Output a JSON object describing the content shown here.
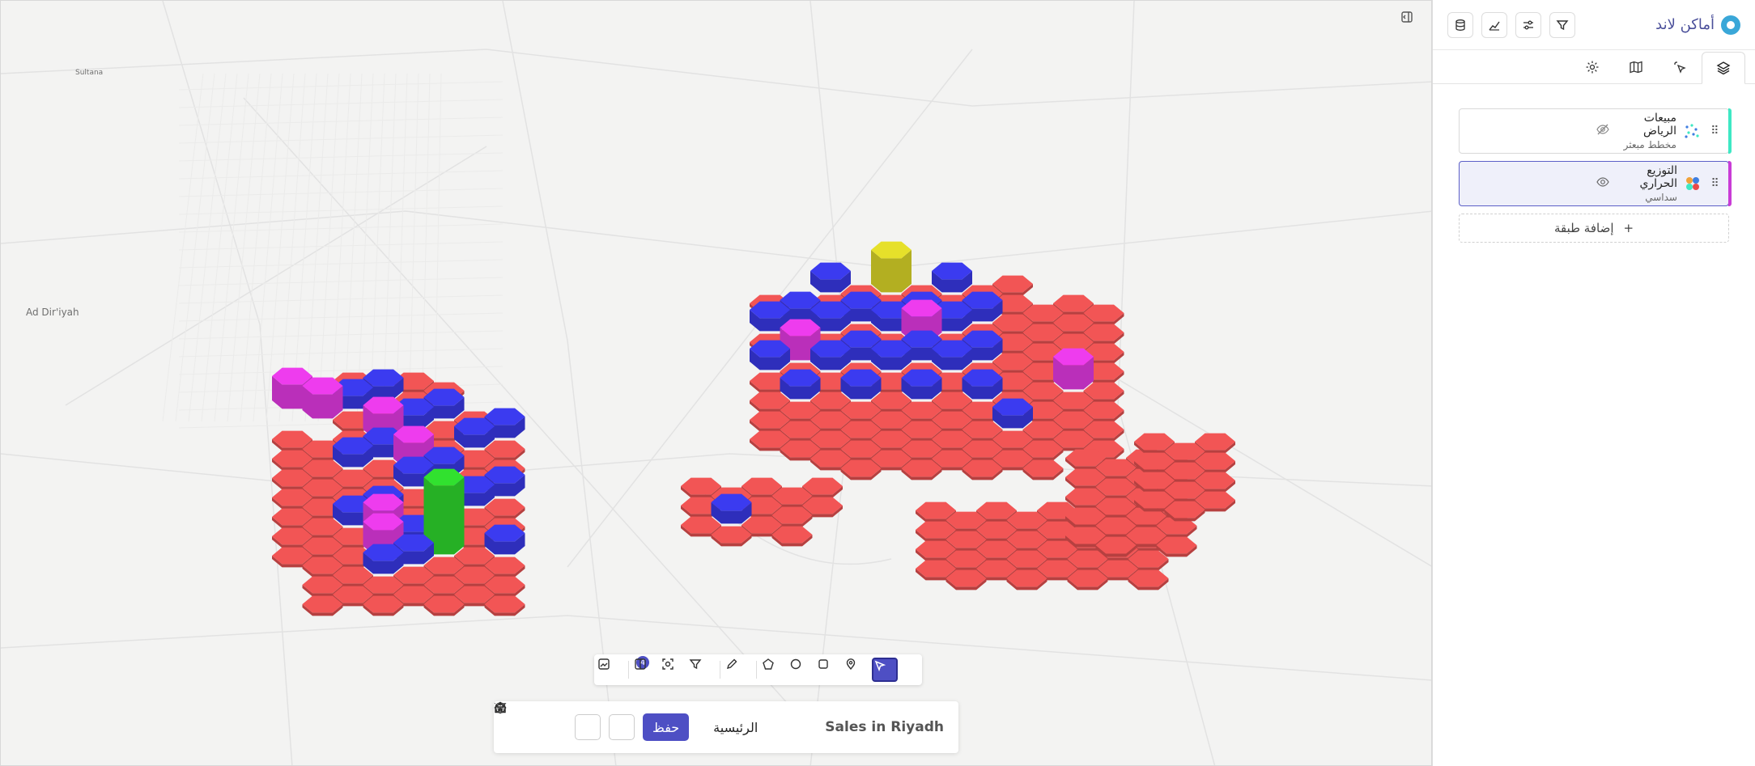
{
  "app": {
    "brand": "أماكن لاند",
    "accent": "#4e4fc4"
  },
  "header_actions": [
    {
      "icon": "database-icon"
    },
    {
      "icon": "chart-icon"
    },
    {
      "icon": "sliders-icon"
    },
    {
      "icon": "filter-icon"
    }
  ],
  "tabs": [
    {
      "name": "layers-tab",
      "icon": "layers-icon",
      "active": true
    },
    {
      "name": "interactions-tab",
      "icon": "pointer-icon"
    },
    {
      "name": "basemap-tab",
      "icon": "map-icon"
    },
    {
      "name": "settings-tab",
      "icon": "gear-icon"
    }
  ],
  "layers": [
    {
      "name": "مبيعات الرياض",
      "subtitle": "مخطط مبعثر",
      "visible": false,
      "color": "#3ee8c4"
    },
    {
      "name": "التوزيع الحراري",
      "subtitle": "سداسي",
      "visible": true,
      "color": "#c93cd6"
    }
  ],
  "add_layer_label": "إضافة طبقة",
  "map": {
    "labels": {
      "sultana": "Sultana",
      "diriyah": "Ad Dir'iyah"
    },
    "hex_colors": {
      "low": "#f25555",
      "mid": "#3b3bf0",
      "high": "#ee3cee",
      "peak": "#e6e02a",
      "max": "#31e12f"
    }
  },
  "toolbar": {
    "badge": "4"
  },
  "bottom": {
    "save_label": "حفظ",
    "home_label": "الرئيسية",
    "title": "Sales in Riyadh"
  }
}
